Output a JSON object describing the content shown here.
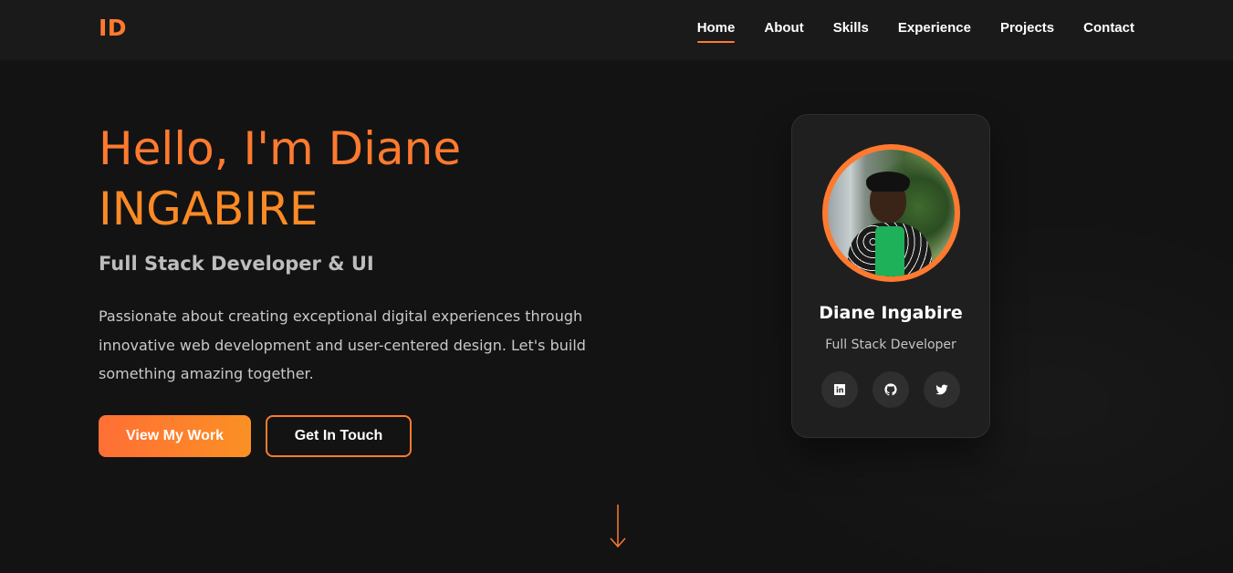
{
  "brand": {
    "logo": "ID",
    "accent": "#ff7a2f"
  },
  "nav": {
    "items": [
      {
        "label": "Home",
        "active": true
      },
      {
        "label": "About",
        "active": false
      },
      {
        "label": "Skills",
        "active": false
      },
      {
        "label": "Experience",
        "active": false
      },
      {
        "label": "Projects",
        "active": false
      },
      {
        "label": "Contact",
        "active": false
      }
    ]
  },
  "hero": {
    "title_line1": "Hello, I'm Diane",
    "title_line2": "INGABIRE",
    "subtitle": "Full Stack Developer & UI",
    "description": "Passionate about creating exceptional digital experiences through innovative web development and user-centered design. Let's build something amazing together.",
    "primary_button": "View My Work",
    "secondary_button": "Get In Touch"
  },
  "profile": {
    "name": "Diane Ingabire",
    "role": "Full Stack Developer",
    "socials": [
      "linkedin-icon",
      "github-icon",
      "twitter-icon"
    ]
  },
  "scroll_indicator": "arrow-down-icon"
}
